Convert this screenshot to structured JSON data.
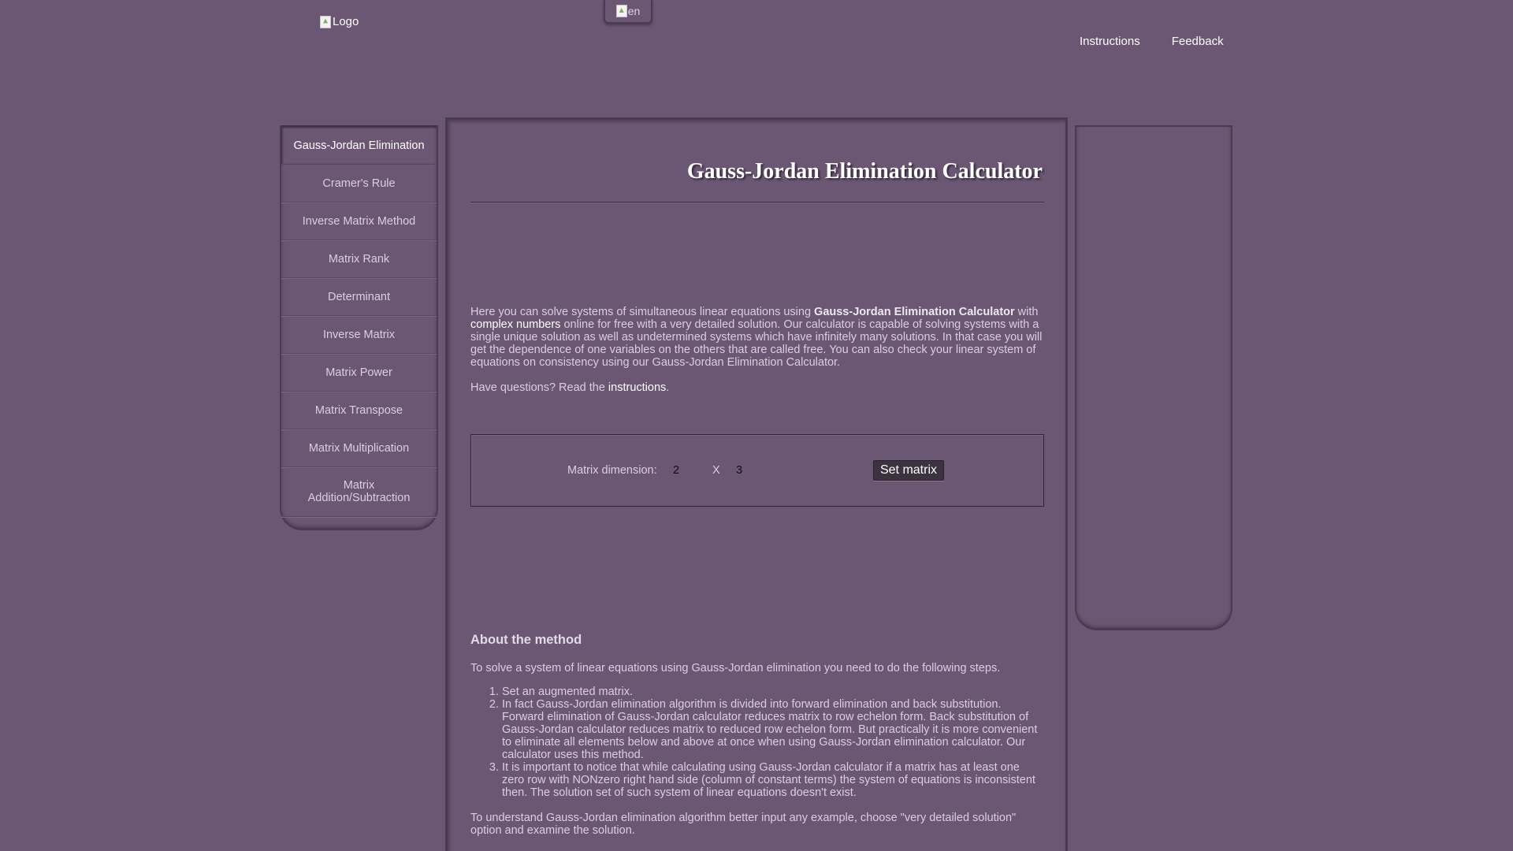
{
  "header": {
    "logo_alt": "Logo",
    "lang_alt": "en",
    "nav": [
      {
        "label": "Instructions"
      },
      {
        "label": "Feedback"
      }
    ]
  },
  "sidebar": {
    "items": [
      {
        "label": "Gauss-Jordan Elimination",
        "active": true
      },
      {
        "label": "Cramer's Rule"
      },
      {
        "label": "Inverse Matrix Method"
      },
      {
        "label": "Matrix Rank"
      },
      {
        "label": "Determinant"
      },
      {
        "label": "Inverse Matrix"
      },
      {
        "label": "Matrix Power"
      },
      {
        "label": "Matrix Transpose"
      },
      {
        "label": "Matrix Multiplication"
      },
      {
        "label": "Matrix Addition/Subtraction"
      }
    ]
  },
  "main": {
    "title": "Gauss-Jordan Elimination Calculator",
    "intro": {
      "p1_a": "Here you can solve systems of simultaneous linear equations using ",
      "p1_bold": "Gauss-Jordan Elimination Calculator",
      "p1_b": " with ",
      "p1_link": "complex numbers",
      "p1_c": " online for free with a very detailed solution. Our calculator is capable of solving systems with a single unique solution as well as undetermined systems which have infinitely many solutions. In that case you will get the dependence of one variables on the others that are called free. You can also check your linear system of equations on consistency using our Gauss-Jordan Elimination Calculator.",
      "q_a": "Have questions? Read the ",
      "q_link": "instructions",
      "q_b": "."
    },
    "matrix_form": {
      "label": "Matrix dimension:",
      "rows": "2",
      "separator": "X",
      "cols": "3",
      "button": "Set matrix"
    },
    "about": {
      "heading": "About the method",
      "intro": "To solve a system of linear equations using Gauss-Jordan elimination you need to do the following steps.",
      "steps": [
        "Set an augmented matrix.",
        "In fact Gauss-Jordan elimination algorithm is divided into forward elimination and back substitution. Forward elimination of Gauss-Jordan calculator reduces matrix to row echelon form. Back substitution of Gauss-Jordan calculator reduces matrix to reduced row echelon form. But practically it is more convenient to eliminate all elements below and above at once when using Gauss-Jordan elimination calculator. Our calculator uses this method.",
        "It is important to notice that while calculating using Gauss-Jordan calculator if a matrix has at least one zero row with NONzero right hand side (column of constant terms) the system of equations is inconsistent then. The solution set of such system of linear equations doesn't exist."
      ],
      "outro": "To understand Gauss-Jordan elimination algorithm better input any example, choose \"very detailed solution\" option and examine the solution."
    }
  }
}
